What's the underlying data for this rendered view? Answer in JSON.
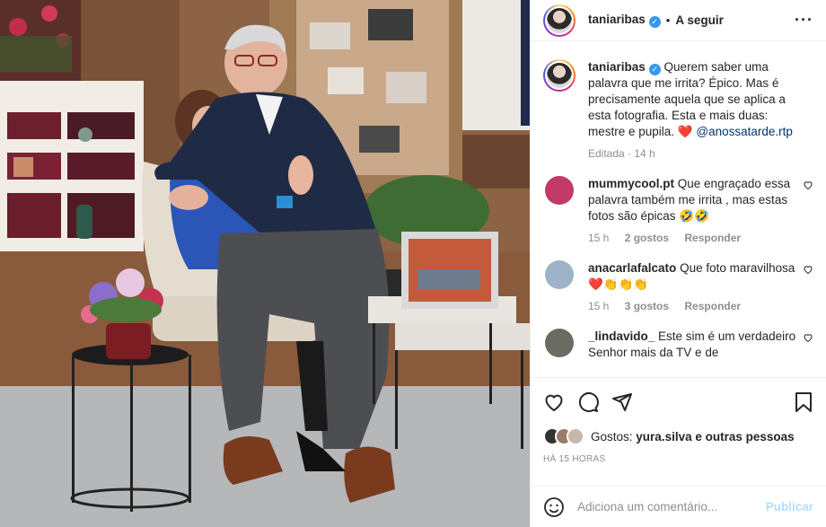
{
  "post": {
    "username": "taniaribas",
    "follow_label": "A seguir",
    "caption_text": "Querem saber uma palavra que me irrita? Épico. Mas é precisamente aquela que se aplica a esta fotografia. Esta e mais duas: mestre e pupila.",
    "caption_mention": "@anossatarde.rtp",
    "edited_label": "Editada",
    "edited_time": "14 h"
  },
  "comments": [
    {
      "user": "mummycool.pt",
      "text": "Que engraçado essa palavra também me irrita , mas estas fotos são épicas 🤣🤣",
      "time": "15 h",
      "likes": "2 gostos",
      "reply": "Responder"
    },
    {
      "user": "anacarlafalcato",
      "text": "Que foto maravilhosa❤️👏👏👏",
      "time": "15 h",
      "likes": "3 gostos",
      "reply": "Responder"
    },
    {
      "user": "_lindavido_",
      "text": "Este sim é um verdadeiro Senhor mais da TV e de"
    }
  ],
  "likes": {
    "prefix": "Gostos:",
    "users": "yura.silva e outras pessoas"
  },
  "post_time": "HÁ 15 HORAS",
  "add_comment": {
    "placeholder": "Adiciona um comentário...",
    "publish": "Publicar"
  },
  "colors": {
    "accent": "#0095f6",
    "publish_disabled": "#b2dffc",
    "heart": "#ed4956",
    "muted": "#8e8e8e"
  },
  "icons": [
    "more-options-icon",
    "verified-badge-icon",
    "heart-icon",
    "comment-icon",
    "share-icon",
    "save-icon",
    "emoji-icon"
  ]
}
